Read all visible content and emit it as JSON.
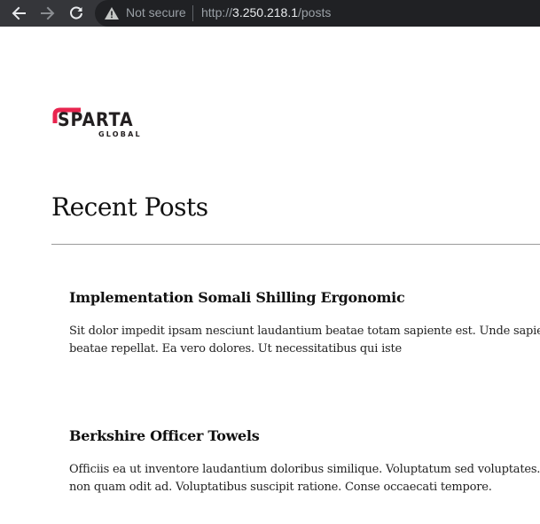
{
  "browser": {
    "security_label": "Not secure",
    "url_scheme": "http://",
    "url_host": "3.250.218.1",
    "url_path": "/posts"
  },
  "logo": {
    "word": "SPARTA",
    "sub": "GLOBAL",
    "accent_color": "#e8254f"
  },
  "page": {
    "title": "Recent Posts"
  },
  "posts": [
    {
      "title": "Implementation Somali Shilling Ergonomic",
      "body": "Sit dolor impedit ipsam nesciunt laudantium beatae totam sapiente est. Unde sapiente deleniti laborum pariatur et beatae repellat. Ea vero dolores. Ut necessitatibus qui iste"
    },
    {
      "title": "Berkshire Officer Towels",
      "body": "Officiis ea ut inventore laudantium doloribus similique. Voluptatum sed voluptates. A molestiae. Soluta aut maxime non quam odit ad. Voluptatibus suscipit ratione. Conse occaecati tempore."
    }
  ]
}
